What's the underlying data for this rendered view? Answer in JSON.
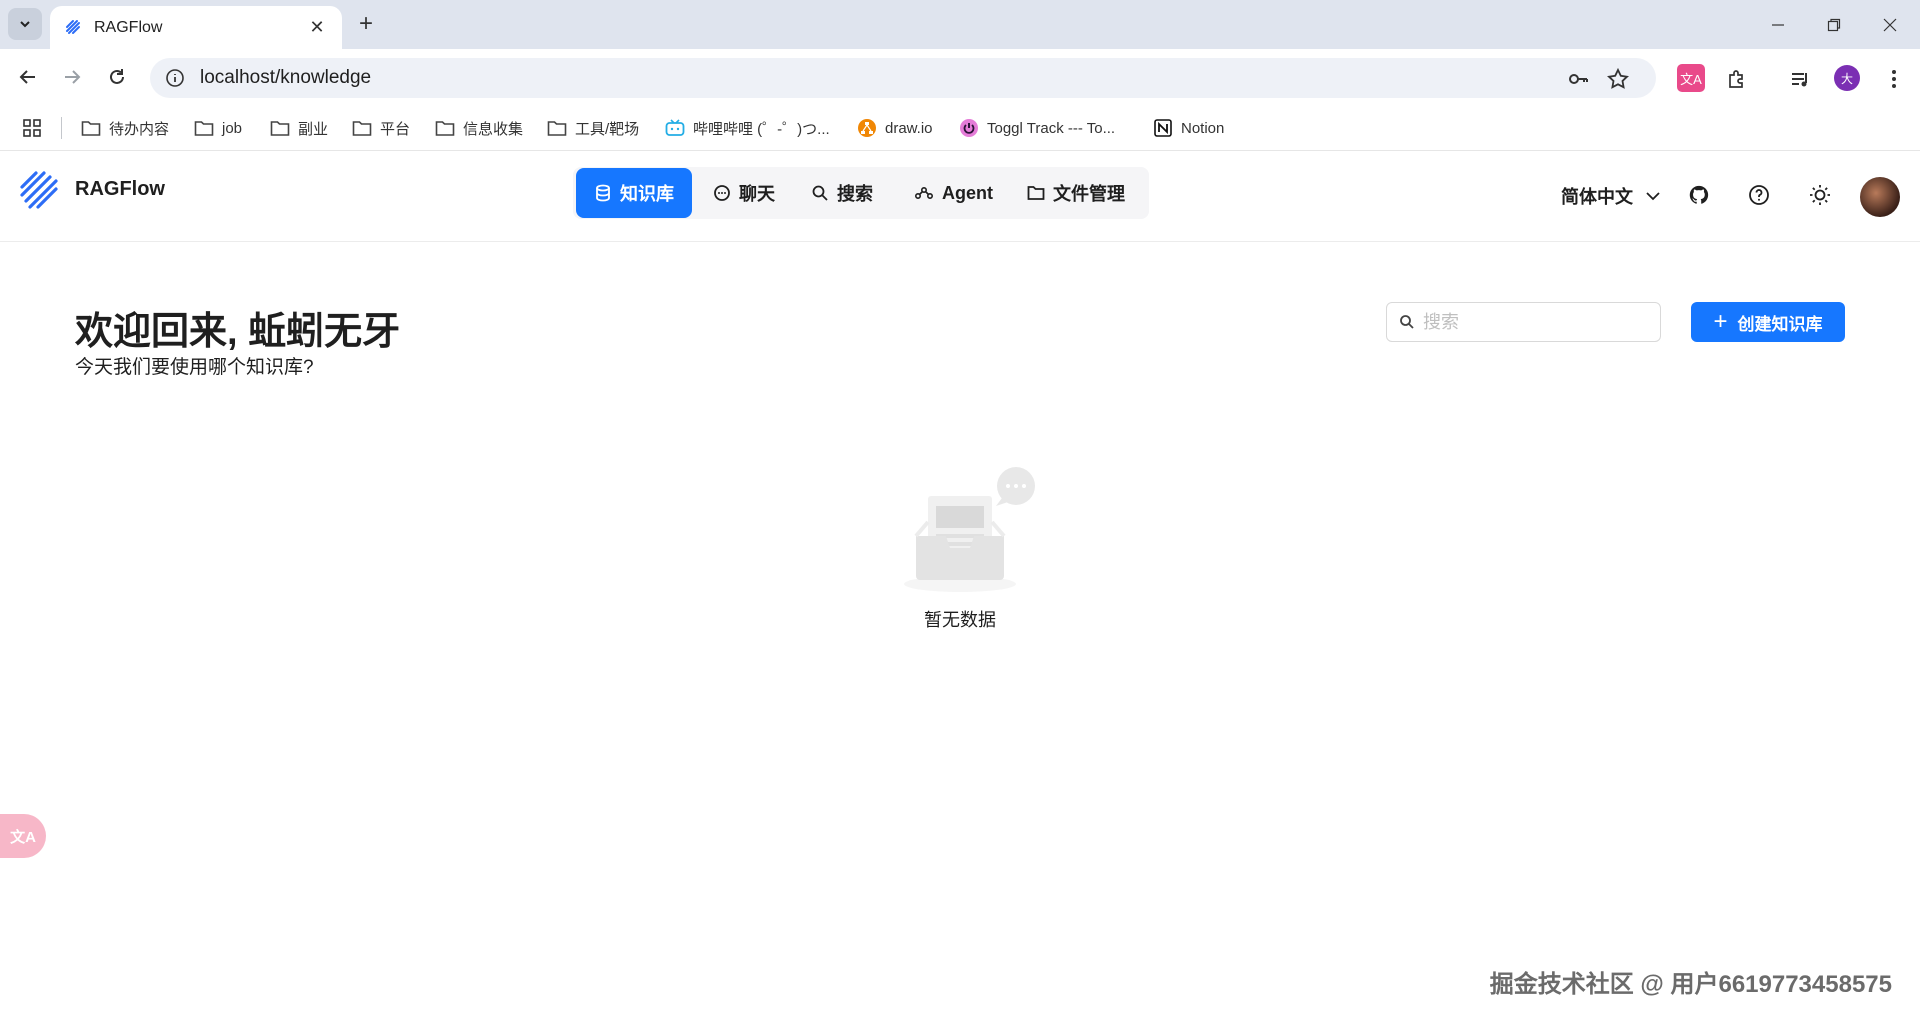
{
  "browser": {
    "tab_title": "RAGFlow",
    "url": "localhost/knowledge",
    "bookmarks": [
      {
        "label": "待办内容",
        "icon": "folder-icon"
      },
      {
        "label": "job",
        "icon": "folder-icon"
      },
      {
        "label": "副业",
        "icon": "folder-icon"
      },
      {
        "label": "平台",
        "icon": "folder-icon"
      },
      {
        "label": "信息收集",
        "icon": "folder-icon"
      },
      {
        "label": "工具/靶场",
        "icon": "folder-icon"
      },
      {
        "label": "哔哩哔哩 (゜-゜)つ...",
        "icon": "bilibili-icon"
      },
      {
        "label": "draw.io",
        "icon": "drawio-icon"
      },
      {
        "label": "Toggl Track --- To...",
        "icon": "toggl-icon"
      },
      {
        "label": "Notion",
        "icon": "notion-icon"
      }
    ],
    "profile_initial": "大"
  },
  "app": {
    "brand": "RAGFlow",
    "nav": [
      {
        "label": "知识库",
        "icon": "database-icon",
        "active": true
      },
      {
        "label": "聊天",
        "icon": "chat-icon",
        "active": false
      },
      {
        "label": "搜索",
        "icon": "search-icon",
        "active": false
      },
      {
        "label": "Agent",
        "icon": "agent-icon",
        "active": false
      },
      {
        "label": "文件管理",
        "icon": "folder-icon",
        "active": false
      }
    ],
    "language": "简体中文",
    "accent": "#1677ff"
  },
  "main": {
    "welcome": "欢迎回来, 蚯蚓无牙",
    "subtitle": "今天我们要使用哪个知识库?",
    "search_placeholder": "搜索",
    "create_label": "创建知识库",
    "empty_text": "暂无数据"
  },
  "floating": {
    "translate_label": "文A"
  },
  "watermark": "掘金技术社区 @ 用户6619773458575"
}
